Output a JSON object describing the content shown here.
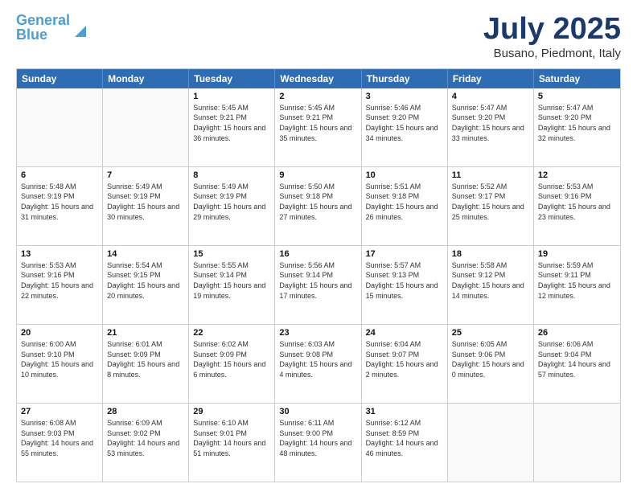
{
  "header": {
    "logo_line1": "General",
    "logo_line2": "Blue",
    "month_title": "July 2025",
    "location": "Busano, Piedmont, Italy"
  },
  "weekdays": [
    "Sunday",
    "Monday",
    "Tuesday",
    "Wednesday",
    "Thursday",
    "Friday",
    "Saturday"
  ],
  "weeks": [
    [
      {
        "day": "",
        "empty": true
      },
      {
        "day": "",
        "empty": true
      },
      {
        "day": "1",
        "sunrise": "Sunrise: 5:45 AM",
        "sunset": "Sunset: 9:21 PM",
        "daylight": "Daylight: 15 hours and 36 minutes."
      },
      {
        "day": "2",
        "sunrise": "Sunrise: 5:45 AM",
        "sunset": "Sunset: 9:21 PM",
        "daylight": "Daylight: 15 hours and 35 minutes."
      },
      {
        "day": "3",
        "sunrise": "Sunrise: 5:46 AM",
        "sunset": "Sunset: 9:20 PM",
        "daylight": "Daylight: 15 hours and 34 minutes."
      },
      {
        "day": "4",
        "sunrise": "Sunrise: 5:47 AM",
        "sunset": "Sunset: 9:20 PM",
        "daylight": "Daylight: 15 hours and 33 minutes."
      },
      {
        "day": "5",
        "sunrise": "Sunrise: 5:47 AM",
        "sunset": "Sunset: 9:20 PM",
        "daylight": "Daylight: 15 hours and 32 minutes."
      }
    ],
    [
      {
        "day": "6",
        "sunrise": "Sunrise: 5:48 AM",
        "sunset": "Sunset: 9:19 PM",
        "daylight": "Daylight: 15 hours and 31 minutes."
      },
      {
        "day": "7",
        "sunrise": "Sunrise: 5:49 AM",
        "sunset": "Sunset: 9:19 PM",
        "daylight": "Daylight: 15 hours and 30 minutes."
      },
      {
        "day": "8",
        "sunrise": "Sunrise: 5:49 AM",
        "sunset": "Sunset: 9:19 PM",
        "daylight": "Daylight: 15 hours and 29 minutes."
      },
      {
        "day": "9",
        "sunrise": "Sunrise: 5:50 AM",
        "sunset": "Sunset: 9:18 PM",
        "daylight": "Daylight: 15 hours and 27 minutes."
      },
      {
        "day": "10",
        "sunrise": "Sunrise: 5:51 AM",
        "sunset": "Sunset: 9:18 PM",
        "daylight": "Daylight: 15 hours and 26 minutes."
      },
      {
        "day": "11",
        "sunrise": "Sunrise: 5:52 AM",
        "sunset": "Sunset: 9:17 PM",
        "daylight": "Daylight: 15 hours and 25 minutes."
      },
      {
        "day": "12",
        "sunrise": "Sunrise: 5:53 AM",
        "sunset": "Sunset: 9:16 PM",
        "daylight": "Daylight: 15 hours and 23 minutes."
      }
    ],
    [
      {
        "day": "13",
        "sunrise": "Sunrise: 5:53 AM",
        "sunset": "Sunset: 9:16 PM",
        "daylight": "Daylight: 15 hours and 22 minutes."
      },
      {
        "day": "14",
        "sunrise": "Sunrise: 5:54 AM",
        "sunset": "Sunset: 9:15 PM",
        "daylight": "Daylight: 15 hours and 20 minutes."
      },
      {
        "day": "15",
        "sunrise": "Sunrise: 5:55 AM",
        "sunset": "Sunset: 9:14 PM",
        "daylight": "Daylight: 15 hours and 19 minutes."
      },
      {
        "day": "16",
        "sunrise": "Sunrise: 5:56 AM",
        "sunset": "Sunset: 9:14 PM",
        "daylight": "Daylight: 15 hours and 17 minutes."
      },
      {
        "day": "17",
        "sunrise": "Sunrise: 5:57 AM",
        "sunset": "Sunset: 9:13 PM",
        "daylight": "Daylight: 15 hours and 15 minutes."
      },
      {
        "day": "18",
        "sunrise": "Sunrise: 5:58 AM",
        "sunset": "Sunset: 9:12 PM",
        "daylight": "Daylight: 15 hours and 14 minutes."
      },
      {
        "day": "19",
        "sunrise": "Sunrise: 5:59 AM",
        "sunset": "Sunset: 9:11 PM",
        "daylight": "Daylight: 15 hours and 12 minutes."
      }
    ],
    [
      {
        "day": "20",
        "sunrise": "Sunrise: 6:00 AM",
        "sunset": "Sunset: 9:10 PM",
        "daylight": "Daylight: 15 hours and 10 minutes."
      },
      {
        "day": "21",
        "sunrise": "Sunrise: 6:01 AM",
        "sunset": "Sunset: 9:09 PM",
        "daylight": "Daylight: 15 hours and 8 minutes."
      },
      {
        "day": "22",
        "sunrise": "Sunrise: 6:02 AM",
        "sunset": "Sunset: 9:09 PM",
        "daylight": "Daylight: 15 hours and 6 minutes."
      },
      {
        "day": "23",
        "sunrise": "Sunrise: 6:03 AM",
        "sunset": "Sunset: 9:08 PM",
        "daylight": "Daylight: 15 hours and 4 minutes."
      },
      {
        "day": "24",
        "sunrise": "Sunrise: 6:04 AM",
        "sunset": "Sunset: 9:07 PM",
        "daylight": "Daylight: 15 hours and 2 minutes."
      },
      {
        "day": "25",
        "sunrise": "Sunrise: 6:05 AM",
        "sunset": "Sunset: 9:06 PM",
        "daylight": "Daylight: 15 hours and 0 minutes."
      },
      {
        "day": "26",
        "sunrise": "Sunrise: 6:06 AM",
        "sunset": "Sunset: 9:04 PM",
        "daylight": "Daylight: 14 hours and 57 minutes."
      }
    ],
    [
      {
        "day": "27",
        "sunrise": "Sunrise: 6:08 AM",
        "sunset": "Sunset: 9:03 PM",
        "daylight": "Daylight: 14 hours and 55 minutes."
      },
      {
        "day": "28",
        "sunrise": "Sunrise: 6:09 AM",
        "sunset": "Sunset: 9:02 PM",
        "daylight": "Daylight: 14 hours and 53 minutes."
      },
      {
        "day": "29",
        "sunrise": "Sunrise: 6:10 AM",
        "sunset": "Sunset: 9:01 PM",
        "daylight": "Daylight: 14 hours and 51 minutes."
      },
      {
        "day": "30",
        "sunrise": "Sunrise: 6:11 AM",
        "sunset": "Sunset: 9:00 PM",
        "daylight": "Daylight: 14 hours and 48 minutes."
      },
      {
        "day": "31",
        "sunrise": "Sunrise: 6:12 AM",
        "sunset": "Sunset: 8:59 PM",
        "daylight": "Daylight: 14 hours and 46 minutes."
      },
      {
        "day": "",
        "empty": true
      },
      {
        "day": "",
        "empty": true
      }
    ]
  ]
}
